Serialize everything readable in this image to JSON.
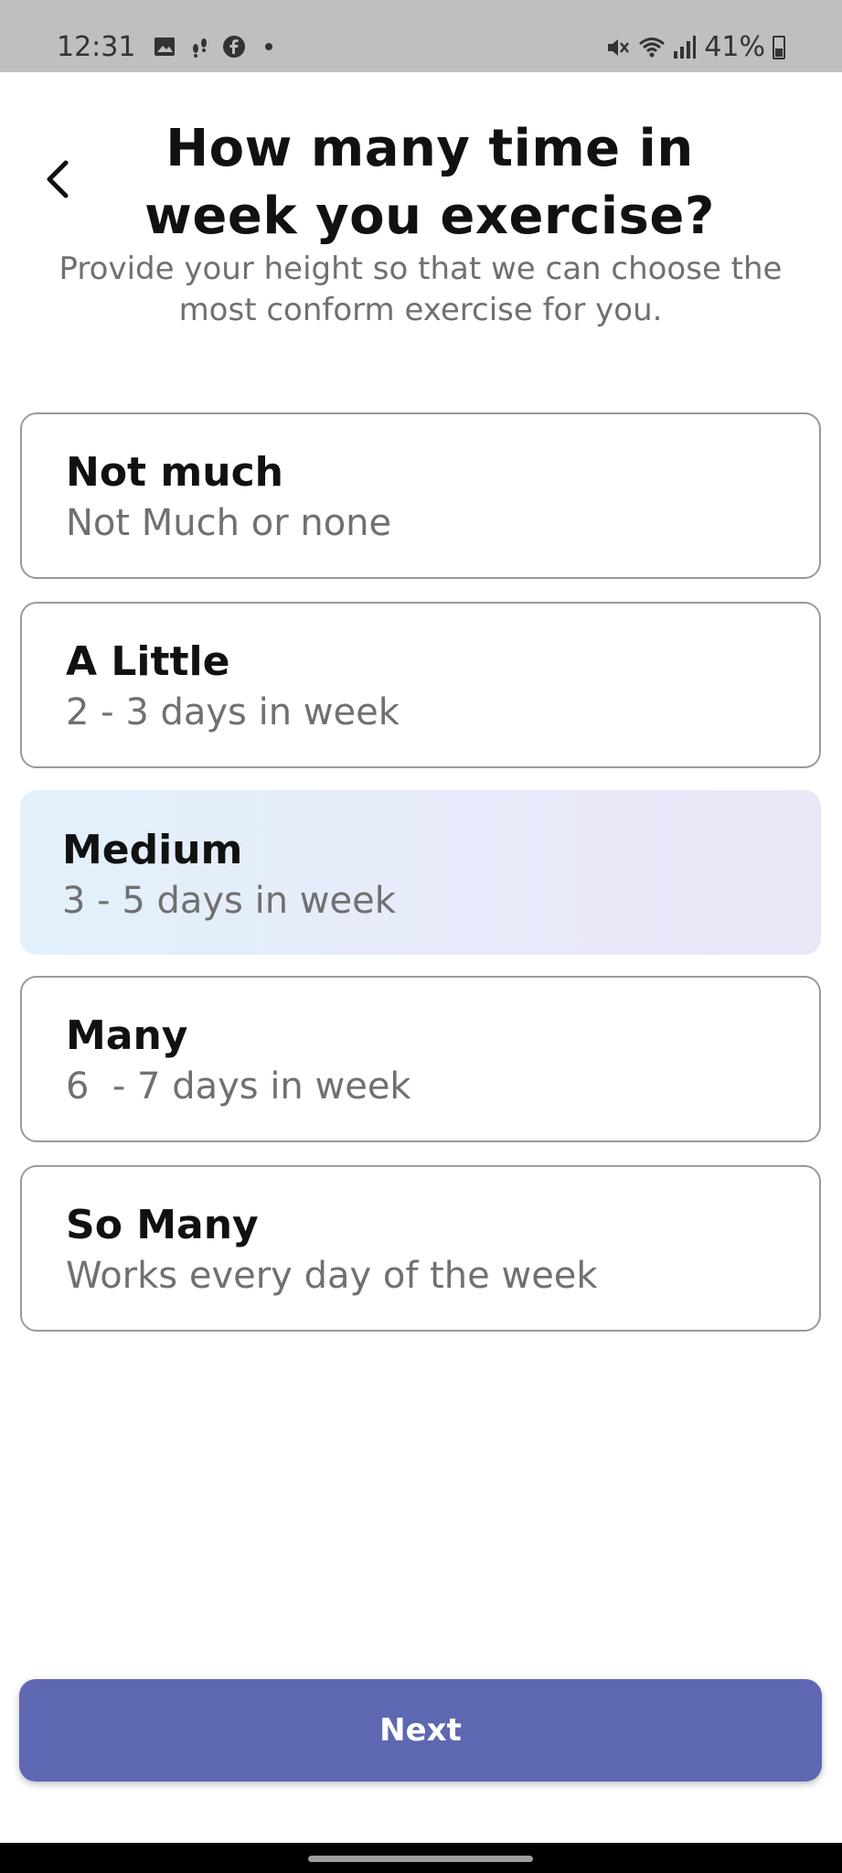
{
  "status_bar": {
    "time": "12:31",
    "battery": "41%",
    "icons_left": [
      "gallery-icon",
      "steps-icon",
      "facebook-icon",
      "dot-icon"
    ],
    "icons_right": [
      "mute-icon",
      "wifi-icon",
      "signal-icon",
      "battery-icon"
    ]
  },
  "header": {
    "title": "How many time in week you exercise?",
    "subtitle": "Provide your height so that we can choose the most conform exercise for you."
  },
  "options": [
    {
      "title": "Not much",
      "subtitle": "Not Much or none",
      "selected": false
    },
    {
      "title": "A Little",
      "subtitle": "2 - 3 days in week",
      "selected": false
    },
    {
      "title": "Medium",
      "subtitle": "3 - 5 days in week",
      "selected": true
    },
    {
      "title": "Many",
      "subtitle": "6  - 7 days in week",
      "selected": false
    },
    {
      "title": "So Many",
      "subtitle": "Works every day of the week",
      "selected": false
    }
  ],
  "footer": {
    "next_label": "Next"
  },
  "colors": {
    "accent": "#5e67b1",
    "selected_gradient_start": "#e2f1fc",
    "selected_gradient_end": "#ebe5f8",
    "border": "#9a9a9a",
    "muted_text": "#707070"
  }
}
